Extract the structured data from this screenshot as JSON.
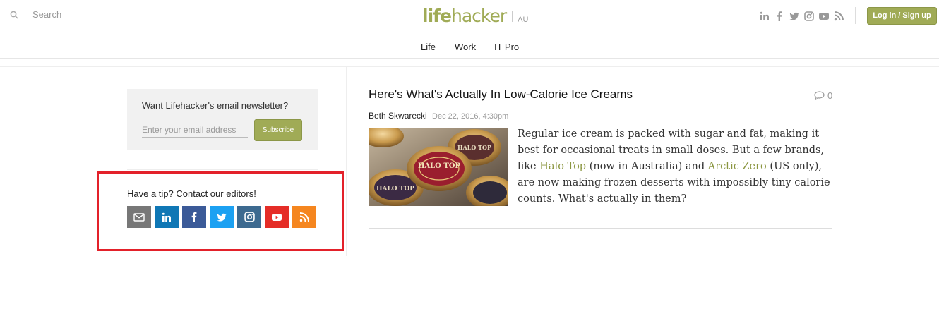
{
  "header": {
    "search_placeholder": "Search",
    "logo_bold": "life",
    "logo_rest": "hacker",
    "region": "AU",
    "social_icons": [
      "linkedin-icon",
      "facebook-icon",
      "twitter-icon",
      "instagram-icon",
      "youtube-icon",
      "rss-icon"
    ],
    "login_label": "Log in / Sign up"
  },
  "nav": {
    "items": [
      "Life",
      "Work",
      "IT Pro"
    ]
  },
  "sidebar": {
    "newsletter_question": "Want Lifehacker's email newsletter?",
    "email_placeholder": "Enter your email address",
    "subscribe_label": "Subscribe",
    "tip_text": "Have a tip? Contact our editors!",
    "tip_icons": [
      {
        "icon": "email-icon",
        "color": "#777777"
      },
      {
        "icon": "linkedin-icon",
        "color": "#0f77b5"
      },
      {
        "icon": "facebook-icon",
        "color": "#3b5a98"
      },
      {
        "icon": "twitter-icon",
        "color": "#1ca1f2"
      },
      {
        "icon": "instagram-icon",
        "color": "#3d6a90"
      },
      {
        "icon": "youtube-icon",
        "color": "#e52d27"
      },
      {
        "icon": "rss-icon",
        "color": "#f5861f"
      }
    ]
  },
  "article": {
    "title": "Here's What's Actually In Low-Calorie Ice Creams",
    "comment_count": "0",
    "author": "Beth Skwarecki",
    "date": "Dec 22, 2016, 4:30pm",
    "excerpt_1": "Regular ice cream is packed with sugar and fat, making it best for occasional treats in small doses. But a few brands, like ",
    "link_1": "Halo Top",
    "excerpt_2": " (now in Australia) and ",
    "link_2": "Arctic Zero",
    "excerpt_3": " (US only), are now making frozen desserts with impossibly tiny calorie counts. What's actually in them?",
    "image_label": "HALO TOP"
  },
  "colors": {
    "brand": "#a0ab56",
    "highlight": "#e3212a",
    "link": "#8b9640"
  }
}
